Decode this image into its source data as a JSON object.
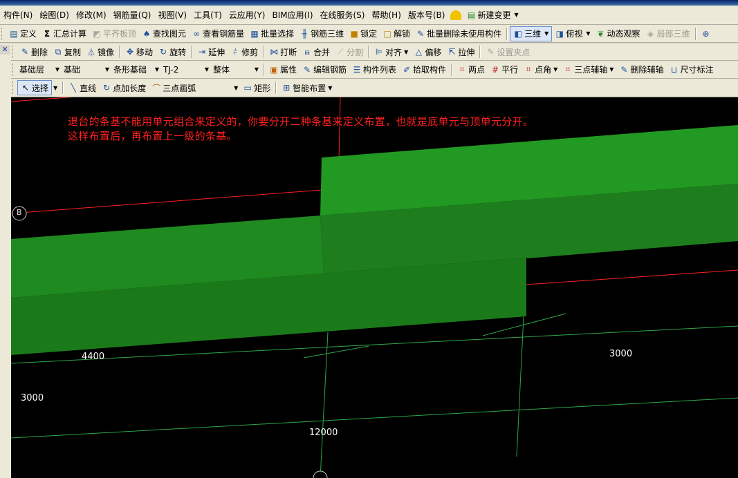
{
  "menu": [
    "构件(N)",
    "绘图(D)",
    "修改(M)",
    "钢筋量(Q)",
    "视图(V)",
    "工具(T)",
    "云应用(Y)",
    "BIM应用(I)",
    "在线服务(S)",
    "帮助(H)",
    "版本号(B)"
  ],
  "menu_extra": "新建变更",
  "toolbar1": {
    "define": "定义",
    "calc": "汇总计算",
    "flush_slab": "平齐板顶",
    "find": "查找图元",
    "view_rebar": "查看钢筋量",
    "batch_select": "批量选择",
    "rebar3d": "钢筋三维",
    "lock": "锁定",
    "unlock": "解锁",
    "batch_delete": "批量删除未使用构件",
    "view3d": "三维",
    "topview": "俯视",
    "dynamic": "动态观察",
    "local3d": "局部三维"
  },
  "toolbar2": {
    "delete": "删除",
    "copy": "复制",
    "mirror": "镜像",
    "move": "移动",
    "rotate": "旋转",
    "extend": "延伸",
    "trim": "修剪",
    "break": "打断",
    "merge": "合并",
    "split": "分割",
    "align": "对齐",
    "offset": "偏移",
    "stretch": "拉伸",
    "set_grip": "设置夹点"
  },
  "toolbar3": {
    "floor": "基础层",
    "category": "基础",
    "type": "条形基础",
    "component": "TJ-2",
    "part": "整体",
    "properties": "属性",
    "edit_rebar": "编辑钢筋",
    "component_list": "构件列表",
    "pick": "拾取构件",
    "two_points": "两点",
    "parallel": "平行",
    "point_angle": "点角",
    "three_point_aux": "三点辅轴",
    "delete_aux": "删除辅轴",
    "dimension": "尺寸标注"
  },
  "toolbar4": {
    "select": "选择",
    "line": "直线",
    "point_length": "点加长度",
    "arc": "三点画弧",
    "rect": "矩形",
    "smart": "智能布置"
  },
  "viewport": {
    "note_line1": "退台的条基不能用单元组合来定义的，你要分开二种条基来定义布置，也就是底单元与顶单元分开。",
    "note_line2": "这样布置后，再布置上一级的条基。",
    "axis_b": "B",
    "dim_4400": "4400",
    "dim_3000_left": "3000",
    "dim_3000_right": "3000",
    "dim_12000": "12000",
    "colors": {
      "background": "#000000",
      "foundation_dark": "#1e7a1e",
      "foundation_light": "#229a22",
      "axis_red": "#ff2020",
      "grid_green": "#2ea84a",
      "note_text": "#ff2020"
    }
  }
}
